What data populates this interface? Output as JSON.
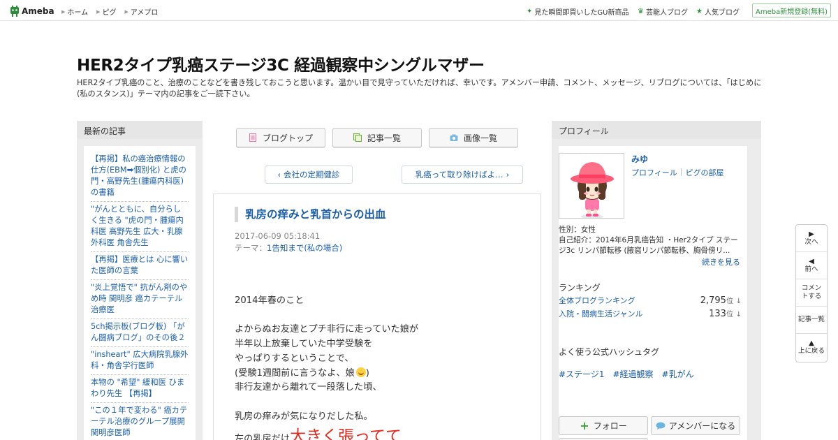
{
  "header": {
    "logo_text": "Ameba",
    "nav": [
      "ホーム",
      "ピグ",
      "アメプロ"
    ],
    "promos": [
      {
        "label": "見た瞬間即買いしたGU新商品",
        "icon": "sparkle-icon"
      },
      {
        "label": "芸能人ブログ",
        "icon": "crown-icon"
      },
      {
        "label": "人気ブログ",
        "icon": "star-icon"
      }
    ],
    "register_label": "Ameba新規登録(無料)"
  },
  "blog": {
    "title": "HER2タイプ乳癌ステージ3C 経過観察中シングルマザー",
    "description": "HER2タイプ乳癌のこと、治療のことなどを書き残しておこうと思います。温かい目で見守っていただければ、幸いです。アメンバー申請、コメント、メッセージ、リブログについては、「はじめに(私のスタンス)」テーマ内の記事をご一読下さい。"
  },
  "left": {
    "heading": "最新の記事",
    "items": [
      "【再掲】私の癌治療情報の仕方(EBM➡個別化) と虎の門・高野先生(腫瘍内科医)の書籍",
      "\"がんとともに、自分らしく生きる \"虎の門・腫瘍内科医 高野先生 広大・乳腺外科医 角舎先生",
      "【再掲】医療とは 心に響いた医師の言葉",
      "\"炎上覚悟で\" 抗がん剤のやめ時 関明彦 癌カテーテル治療医",
      "5ch掲示板(ブログ板) 「がん闘病ブログ」のその後２",
      "\"insheart\" 広大病院乳腺外科・角舎学行医師",
      "本物の \"希望\" 緩和医 ひまわり先生 【再掲】",
      "\"この１年で変わる\" 癌カテーテル治療のグループ展開 関明彦医師"
    ]
  },
  "center": {
    "tabs": [
      "ブログトップ",
      "記事一覧",
      "画像一覧"
    ],
    "prev_label": "会社の定期健診",
    "next_label": "乳癌って取り除けばよ…",
    "article": {
      "title": "乳房の痒みと乳首からの出血",
      "date": "2017-06-09 05:18:41",
      "theme_prefix": "テーマ：",
      "theme": "1告知まで(私の場合)",
      "lines": [
        "2014年春のこと",
        "",
        "よからぬお友達とプチ非行に走っていた娘が",
        "半年以上放棄していた中学受験を",
        "やっぱりするということで、",
        "(受験1週間前に言うなよ、娘",
        "非行友達から離れて一段落した頃、",
        "",
        "乳房の痒みが気になりだした私。"
      ],
      "line_closing": ")",
      "last_line_prefix": "左の乳房だけ",
      "last_line_highlight": "大きく張ってて"
    }
  },
  "right": {
    "heading": "プロフィール",
    "name": "みゆ",
    "link_profile": "プロフィール",
    "link_pig": "ピグの部屋",
    "gender": "性別：女性",
    "intro": "自己紹介：2014年6月乳癌告知 ・Her2タイプ ステージ3c リンパ節転移 (腋窩リンパ節転移、胸骨傍リ...",
    "more": "続きを見る",
    "ranking_heading": "ランキング",
    "rankings": [
      {
        "label": "全体ブログランキング",
        "value": "2,795",
        "unit": "位",
        "arrow": "↓"
      },
      {
        "label": "入院・闘病生活ジャンル",
        "value": "133",
        "unit": "位",
        "arrow": "↓"
      }
    ],
    "hashtag_heading": "よく使う公式ハッシュタグ",
    "hashtags": [
      "#ステージ1",
      "#経過観察",
      "#乳がん"
    ],
    "follow_label": "フォロー",
    "amember_label": "アメンバーになる"
  },
  "side_nav": [
    {
      "label": "次へ",
      "icon": "arrow-right-icon"
    },
    {
      "label": "前へ",
      "icon": "arrow-left-icon"
    },
    {
      "label": "コメントする",
      "icon": ""
    },
    {
      "label": "記事一覧",
      "icon": ""
    },
    {
      "label": "上に戻る",
      "icon": "arrow-up-icon"
    }
  ],
  "colors": {
    "link": "#1a5ea9",
    "brand_green": "#2d8c3c",
    "highlight_red": "#e3281e",
    "column_bg": "#ececec"
  }
}
